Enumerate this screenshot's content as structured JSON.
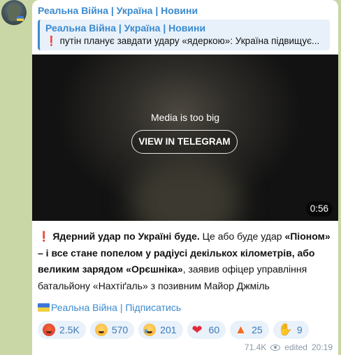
{
  "channel": {
    "name": "Реальна Війна | Україна | Новини"
  },
  "quote": {
    "title": "Реальна Війна | Україна | Новини",
    "text": "путін планує завдати удару «ядеркою»: Україна підвищує...",
    "mark": "❗"
  },
  "media": {
    "notice": "Media is too big",
    "button_label": "VIEW IN TELEGRAM",
    "duration": "0:56"
  },
  "message": {
    "mark": "❗",
    "bold_1": "Ядерний удар по Україні буде.",
    "text_1": " Це або буде удар ",
    "bold_2": "«Піоном» – і все стане попелом у радіусі декількох кілометрів, або великим зарядом «Орєшніка»",
    "text_2": ", заявив офіцер управління батальйону «Нахтіґаль» з позивним Майор Джміль"
  },
  "subscribe": {
    "label": "Реальна Війна | Підписатись"
  },
  "reactions": [
    {
      "icon": "angry-face-icon",
      "count": "2.5K"
    },
    {
      "icon": "grinning-face-icon",
      "count": "570"
    },
    {
      "icon": "crying-face-icon",
      "count": "201"
    },
    {
      "icon": "heart-icon",
      "count": "60"
    },
    {
      "icon": "fire-icon",
      "count": "25"
    },
    {
      "icon": "thumbs-up-icon",
      "count": "9"
    }
  ],
  "meta": {
    "views": "71.4K",
    "edited": "edited",
    "time": "20:19"
  },
  "colors": {
    "accent": "#3a8ad0",
    "background": "#c9d6a6",
    "alert": "#d9252c"
  }
}
